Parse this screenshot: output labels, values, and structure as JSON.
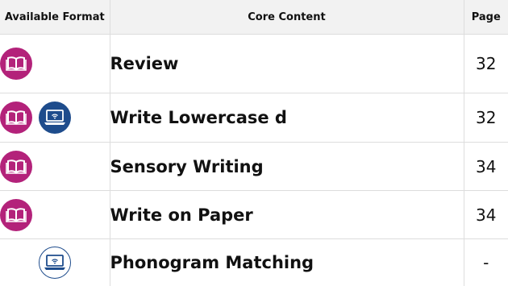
{
  "table": {
    "headers": {
      "format": "Available Format",
      "content": "Core Content",
      "page": "Page"
    },
    "rows": [
      {
        "title": "Review",
        "page": "32",
        "formats": [
          "book-icon"
        ]
      },
      {
        "title": "Write Lowercase d",
        "page": "32",
        "formats": [
          "book-icon",
          "digital-device-icon"
        ]
      },
      {
        "title": "Sensory Writing",
        "page": "34",
        "formats": [
          "book-icon"
        ]
      },
      {
        "title": "Write on Paper",
        "page": "34",
        "formats": [
          "book-icon"
        ]
      },
      {
        "title": "Phonogram Matching",
        "page": "-",
        "formats": [
          "digital-device-icon"
        ]
      }
    ]
  },
  "colors": {
    "book": "#b3227a",
    "digital": "#1e4c8c",
    "header_bg": "#f2f2f2",
    "grid": "#dddddd"
  }
}
